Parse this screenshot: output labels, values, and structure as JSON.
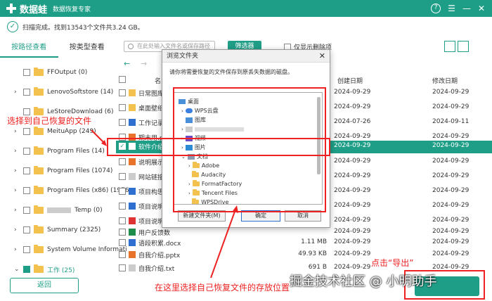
{
  "app": {
    "name": "数据蛙",
    "subtitle": "数据恢复专家"
  },
  "window_controls": {
    "help": "?",
    "menu": "☰",
    "minimize": "—",
    "close": "✕"
  },
  "status": {
    "text": "扫描完成。找到13543个文件共3.24 GB。"
  },
  "tabs": [
    {
      "label": "按路径查看"
    },
    {
      "label": "按类型查看"
    }
  ],
  "tree": [
    {
      "label": "FFOutput (0)"
    },
    {
      "label": "LenovoSoftstore (14)"
    },
    {
      "label": "LeStoreDownload (6)"
    },
    {
      "label": "MeituApp (249)"
    },
    {
      "label": "Program Files (14)"
    },
    {
      "label": "Program Files (1074)"
    },
    {
      "label": "Program Files (x86) (1976"
    },
    {
      "label": "Temp (0)"
    },
    {
      "label": "Summary (2325)"
    },
    {
      "label": "System Volume Informati"
    },
    {
      "label": "工作 (25)"
    }
  ],
  "toolbar": {
    "search_placeholder": "在此处输入文件名或保存路径",
    "filter_label": "筛选器",
    "only_deleted": "仅显示删除项"
  },
  "table": {
    "headers": {
      "name": "名",
      "created": "创建日期",
      "modified": "修改日期"
    },
    "rows": [
      {
        "name": "日常图库",
        "size": "",
        "created": "2024-09-29",
        "modified": "2024-09-29"
      },
      {
        "name": "桌面壁纸",
        "size": "",
        "created": "2024-09-29",
        "modified": "2024-09-29"
      },
      {
        "name": "工作记录1.",
        "size": "",
        "created": "2024-07-26",
        "modified": "2024-09-11"
      },
      {
        "name": "期末用.ppt",
        "size": "",
        "created": "2024-09-29",
        "modified": "2024-09-29"
      },
      {
        "name": "软件介绍",
        "size": "",
        "created": "2024-09-29",
        "modified": "2024-09-29"
      },
      {
        "name": "说明展示.p",
        "size": "",
        "created": "2024-09-29",
        "modified": "2024-09-29"
      },
      {
        "name": "网站链接.t",
        "size": "",
        "created": "2024-09-29",
        "modified": "2024-09-29"
      },
      {
        "name": "项目构思.d",
        "size": "",
        "created": "2024-09-29",
        "modified": "2024-09-29"
      },
      {
        "name": "项目说明书",
        "size": "",
        "created": "2024-09-29",
        "modified": "2024-09-29"
      },
      {
        "name": "项目说明书",
        "size": "",
        "created": "2024-09-29",
        "modified": "2024-09-29"
      },
      {
        "name": "用户反馈数",
        "size": "",
        "created": "2024-09-29",
        "modified": "2024-09-29"
      },
      {
        "name": "语段积累.docx",
        "size": "1.11 MB",
        "created": "2024-09-29",
        "modified": "2024-09-29"
      },
      {
        "name": "自我介绍.pptx",
        "size": "49.93 KB",
        "created": "2024-09-29",
        "modified": "2024-09-29"
      },
      {
        "name": "自我介绍.txt",
        "size": "691 B",
        "created": "2024-09-29",
        "modified": "2024-09-29"
      }
    ]
  },
  "dialog": {
    "title": "浏览文件夹",
    "message": "请你将需要恢复的文件保存到原丢失数据的磁盘。",
    "items": [
      {
        "label": "桌面"
      },
      {
        "label": "WPS云盘"
      },
      {
        "label": "图库"
      },
      {
        "label": "视频"
      },
      {
        "label": "图片"
      },
      {
        "label": "文档"
      },
      {
        "label": "Adobe"
      },
      {
        "label": "Audacity"
      },
      {
        "label": "FormatFactory"
      },
      {
        "label": "Tencent Files"
      },
      {
        "label": "WPSDrive"
      }
    ],
    "new_folder": "新建文件夹(M)",
    "ok": "确定",
    "cancel": "取消"
  },
  "buttons": {
    "back": "返回"
  },
  "annotations": {
    "select_file": "选择到自己恢复的文件",
    "click_export": "点击“导出”",
    "choose_location": "在这里选择自己恢复文件的存放位置"
  },
  "watermark": "掘金技术社区 @ 小明助手",
  "colors": {
    "accent": "#1f9e87",
    "annotation": "#e22222"
  }
}
